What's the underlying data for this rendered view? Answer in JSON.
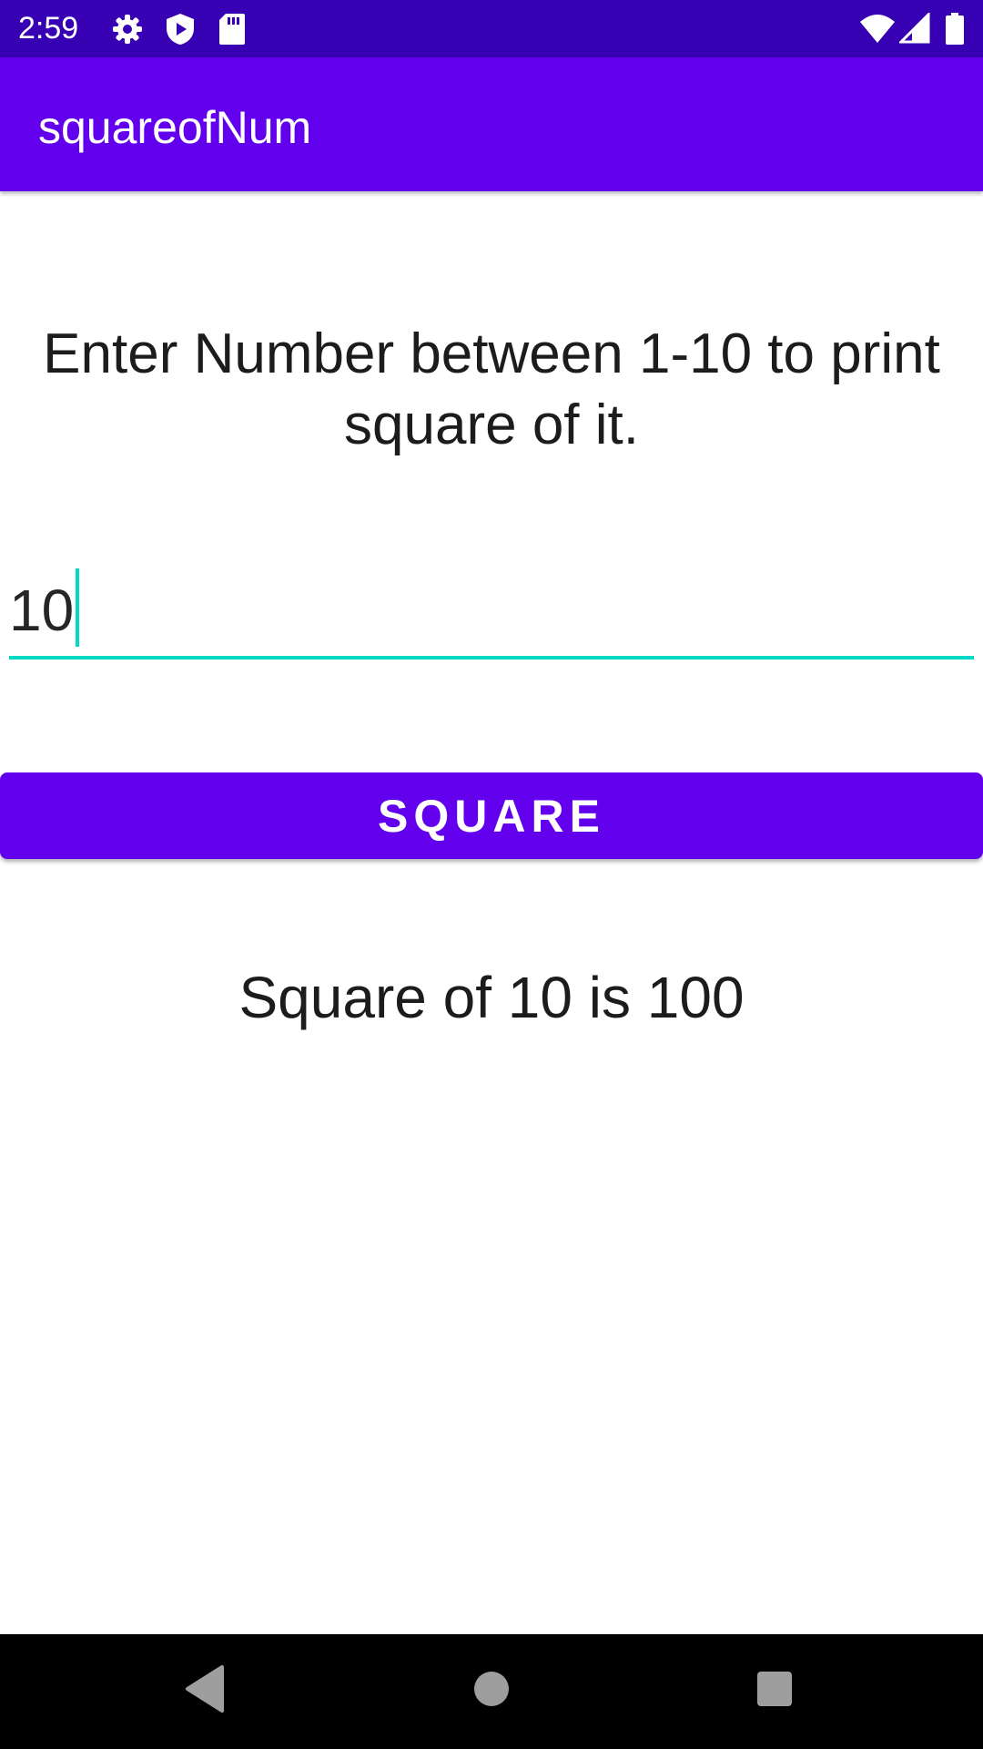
{
  "status_bar": {
    "time": "2:59",
    "icons": [
      "gear-icon",
      "shield-icon",
      "sd-card-icon",
      "wifi-icon",
      "signal-icon",
      "battery-icon"
    ]
  },
  "app_bar": {
    "title": "squareofNum"
  },
  "main": {
    "instruction": "Enter Number between 1-10 to print square of it.",
    "input_value": "10",
    "button_label": "SQUARE",
    "result_text": "Square of 10 is 100"
  },
  "nav_bar": {
    "buttons": [
      "back-icon",
      "home-icon",
      "recents-icon"
    ]
  },
  "colors": {
    "status_bar": "#3700b3",
    "primary": "#6200ee",
    "accent": "#03dac5"
  }
}
